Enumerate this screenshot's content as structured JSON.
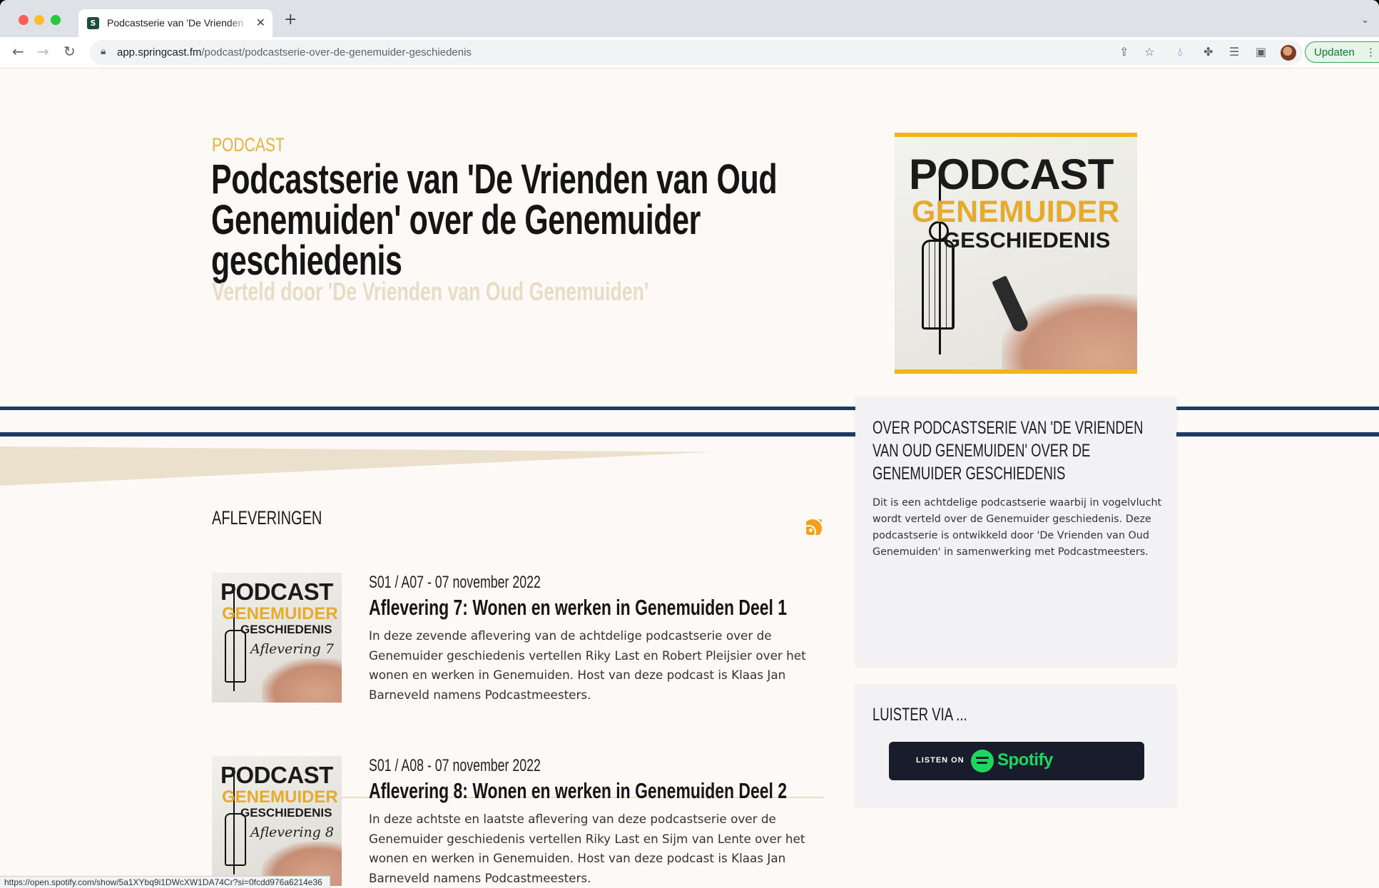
{
  "browser": {
    "tab_title": "Podcastserie van 'De Vrienden",
    "tab_favicon": "S",
    "url_host": "app.springcast.fm",
    "url_path": "/podcast/podcastserie-over-de-genemuider-geschiedenis",
    "update_label": "Updaten",
    "status_url": "https://open.spotify.com/show/5a1XYbq9i1DWcXW1DA74Cr?si=0fcdd976a6214e36",
    "icons": [
      "back-icon",
      "forward-icon",
      "reload-icon",
      "lock-icon",
      "share-icon",
      "bookmark-star-icon",
      "extension-drop-icon",
      "puzzle-icon",
      "reading-list-icon",
      "sidebar-icon",
      "profile-avatar",
      "more-menu-icon"
    ]
  },
  "hero": {
    "eyebrow": "PODCAST",
    "title": "Podcastserie van 'De Vrienden van Oud Genemuiden' over de Genemuider geschiedenis",
    "subtitle": "Verteld door 'De Vrienden van Oud Genemuiden'"
  },
  "cover": {
    "line1": "PODCAST",
    "line2": "GENEMUIDER",
    "line3": "GESCHIEDENIS"
  },
  "about": {
    "heading": "Over Podcastserie van 'De Vrienden van Oud Genemuiden' over de Genemuider geschiedenis",
    "body": "Dit is een achtdelige podcastserie waarbij in vogelvlucht wordt verteld over de Genemuider geschiedenis. Deze podcastserie is ontwikkeld door 'De Vrienden van Oud Genemuiden' in samenwerking met Podcastmeesters."
  },
  "listen": {
    "heading": "LUISTER VIA ...",
    "button_prefix": "LISTEN ON",
    "button_brand": "Spotify"
  },
  "episodes": {
    "heading": "AFLEVERINGEN",
    "items": [
      {
        "meta": "S01 / A07 - 07 november 2022",
        "title": "Aflevering 7: Wonen en werken in Genemuiden Deel 1",
        "description": "In deze zevende aflevering van de achtdelige podcastserie over de Genemuider geschiedenis vertellen Riky Last en Robert Pleijsier over het wonen en werken in Genemuiden. Host van deze podcast is Klaas Jan Barneveld namens Podcastmeesters.",
        "thumb": {
          "line1": "PODCAST",
          "line2": "GENEMUIDER",
          "line3": "GESCHIEDENIS",
          "label": "Aflevering 7"
        }
      },
      {
        "meta": "S01 / A08 - 07 november 2022",
        "title": "Aflevering 8: Wonen en werken in Genemuiden Deel 2",
        "description": "In deze achtste en laatste aflevering van deze podcastserie over de Genemuider geschiedenis vertellen Riky Last en Sijm van Lente over het wonen en werken in Genemuiden. Host van deze podcast is Klaas Jan Barneveld namens Podcastmeesters.",
        "thumb": {
          "line1": "PODCAST",
          "line2": "GENEMUIDER",
          "line3": "GESCHIEDENIS",
          "label": "Aflevering 8"
        }
      }
    ]
  },
  "colors": {
    "accent_gold": "#e8b13c",
    "stripe_navy": "#1d3a67",
    "spotify_green": "#1ed760",
    "page_bg": "#fcf9f7"
  }
}
